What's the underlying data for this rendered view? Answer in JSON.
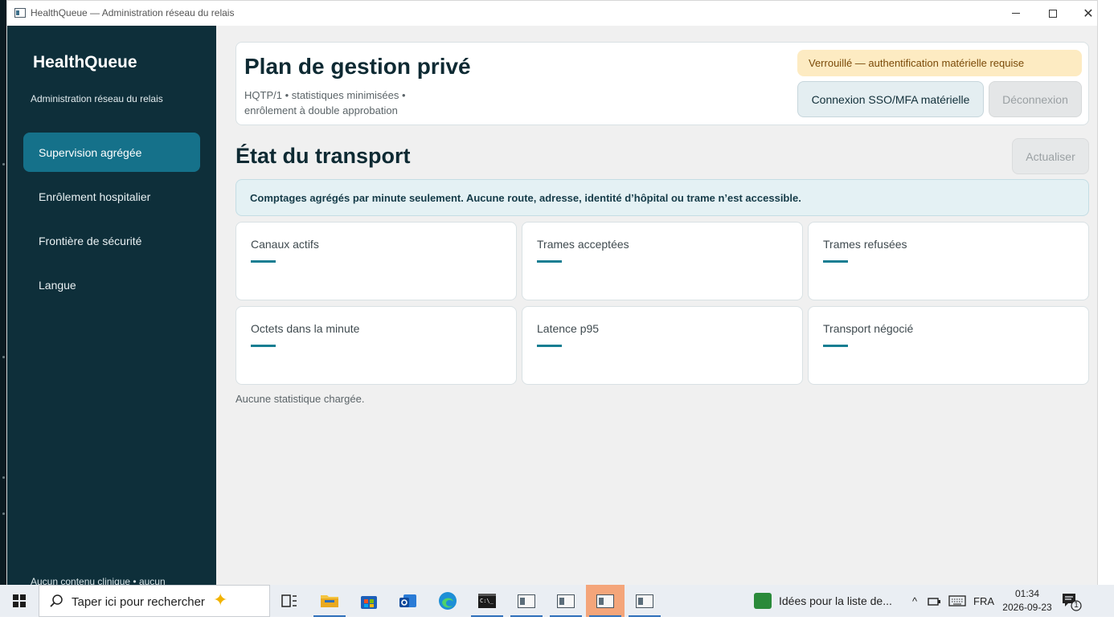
{
  "window": {
    "title": "HealthQueue — Administration réseau du relais"
  },
  "sidebar": {
    "brand": "HealthQueue",
    "subtitle": "Administration réseau du relais",
    "items": [
      {
        "label": "Supervision agrégée",
        "active": true
      },
      {
        "label": "Enrôlement hospitalier",
        "active": false
      },
      {
        "label": "Frontière de sécurité",
        "active": false
      },
      {
        "label": "Langue",
        "active": false
      }
    ],
    "footer": "Aucun contenu clinique • aucun"
  },
  "header": {
    "title": "Plan de gestion privé",
    "subtitle_line1": "HQTP/1 • statistiques minimisées •",
    "subtitle_line2": "enrôlement à double approbation",
    "lock_status": "Verrouillé — authentification matérielle requise",
    "sso_button": "Connexion SSO/MFA matérielle",
    "logout_button": "Déconnexion"
  },
  "transport": {
    "title": "État du transport",
    "refresh_button": "Actualiser",
    "banner": "Comptages agrégés par minute seulement. Aucune route, adresse, identité d’hôpital ou trame n’est accessible.",
    "stats": [
      {
        "label": "Canaux actifs",
        "value": "—"
      },
      {
        "label": "Trames acceptées",
        "value": "—"
      },
      {
        "label": "Trames refusées",
        "value": "—"
      },
      {
        "label": "Octets dans la minute",
        "value": "—"
      },
      {
        "label": "Latence p95",
        "value": "—"
      },
      {
        "label": "Transport négocié",
        "value": "—"
      }
    ],
    "status": "Aucune statistique chargée."
  },
  "taskbar": {
    "search_placeholder": "Taper ici pour rechercher",
    "notification_app": "Idées pour la liste de...",
    "language": "FRA",
    "time": "01:34",
    "date": "2026-09-23",
    "notification_count": "1"
  },
  "colors": {
    "sidebar_bg": "#0e2f3a",
    "accent": "#15718a",
    "warning_bg": "#fdebc2",
    "info_bg": "#e4f1f4"
  }
}
